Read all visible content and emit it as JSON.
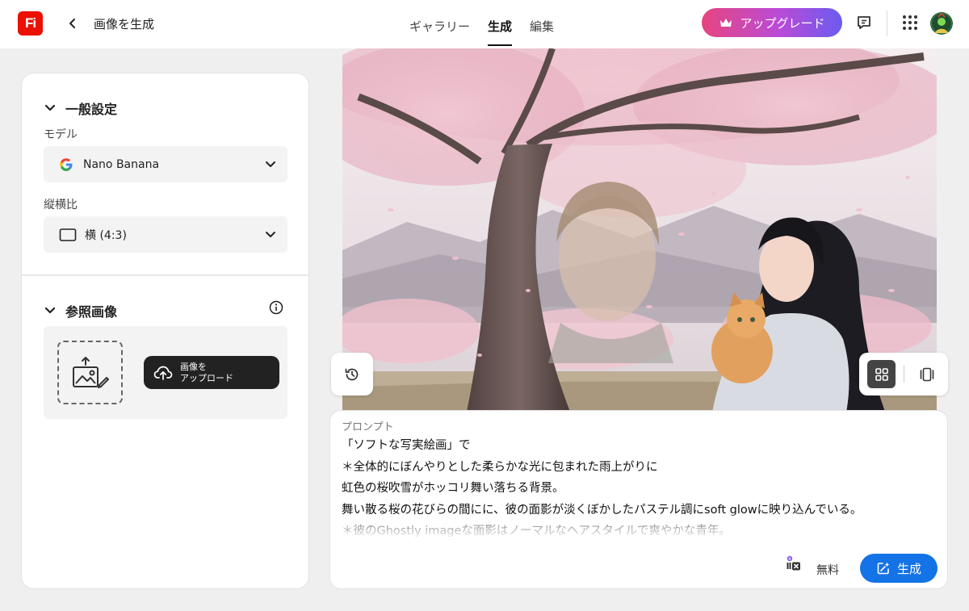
{
  "app": {
    "logo_text": "Fi",
    "page_title": "画像を生成"
  },
  "nav": {
    "tabs": [
      {
        "label": "ギャラリー",
        "active": false
      },
      {
        "label": "生成",
        "active": true
      },
      {
        "label": "編集",
        "active": false
      }
    ]
  },
  "header": {
    "upgrade_label": "アップグレード",
    "icons": [
      "back-chevron-icon",
      "crown-icon",
      "feedback-icon",
      "app-grid-icon",
      "avatar"
    ]
  },
  "settings": {
    "general_title": "一般設定",
    "model_label": "モデル",
    "model_value": "Nano Banana",
    "aspect_label": "縦横比",
    "aspect_value": "横 (4:3)",
    "reference_title": "参照画像",
    "upload_label": "画像を\nアップロード"
  },
  "prompt": {
    "label": "プロンプト",
    "lines": [
      "「ソフトな写実絵画」で",
      "＊全体的にぼんやりとした柔らかな光に包まれた雨上がりに",
      "虹色の桜吹雪がホッコリ舞い落ちる背景。",
      "舞い散る桜の花びらの間にに、彼の面影が淡くぼかしたパステル調にsoft glowに映り込んでいる。",
      "＊彼のGhostly imageな面影はノーマルなヘアスタイルで爽やかな青年。"
    ],
    "cost_label": "無料",
    "generate_label": "生成"
  },
  "colors": {
    "accent_blue": "#1473e6",
    "brand_red": "#eb1000",
    "upgrade_gradient_start": "#e6457f",
    "upgrade_gradient_end": "#6a5cf0"
  }
}
